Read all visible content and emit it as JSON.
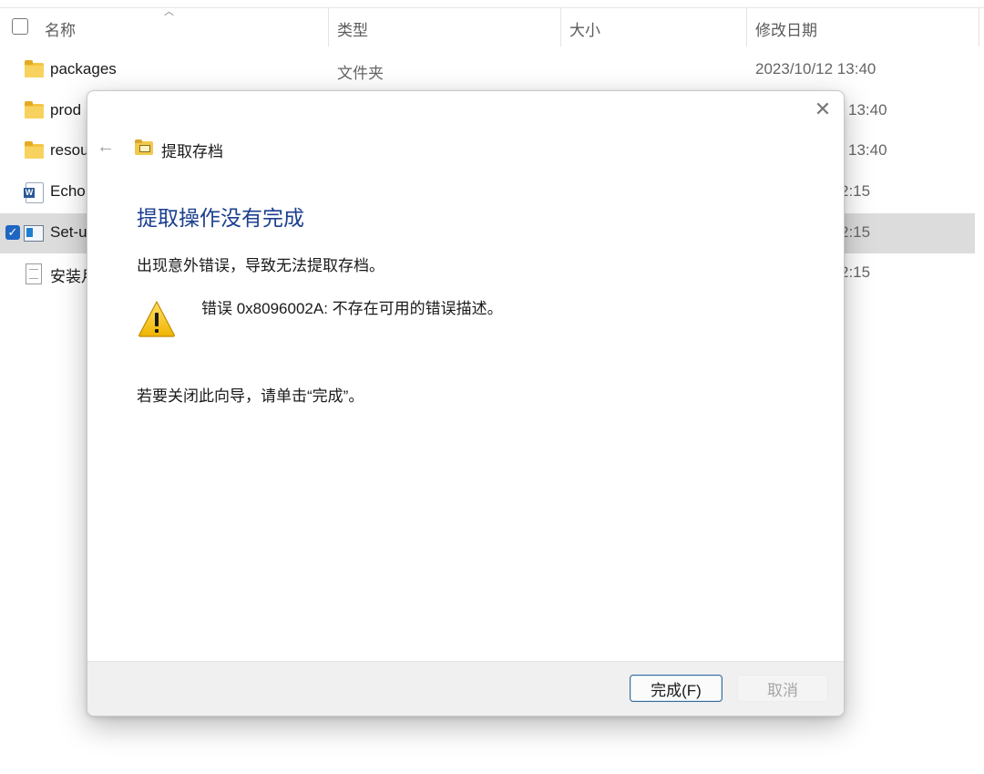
{
  "explorer": {
    "columns": {
      "name": "名称",
      "type": "类型",
      "size": "大小",
      "modified": "修改日期"
    },
    "rows": [
      {
        "name": "packages",
        "type": "文件夹",
        "date": "2023/10/12 13:40"
      },
      {
        "name": "prod",
        "date": "13:40"
      },
      {
        "name": "resou",
        "date": "13:40"
      },
      {
        "name": "Echo",
        "date": "2:15"
      },
      {
        "name": "Set-u",
        "date": "2:15"
      },
      {
        "name": "安装月",
        "date": "2:15"
      }
    ]
  },
  "dialog": {
    "wizard_title": "提取存档",
    "main_title": "提取操作没有完成",
    "description": "出现意外错误，导致无法提取存档。",
    "error_message": "错误 0x8096002A: 不存在可用的错误描述。",
    "close_hint": "若要关闭此向导，请单击“完成”。",
    "buttons": {
      "finish": "完成(F)",
      "cancel": "取消"
    }
  }
}
